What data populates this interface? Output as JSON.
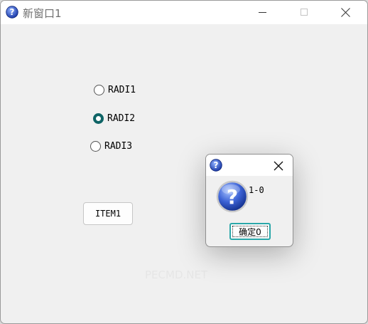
{
  "window": {
    "title": "新窗口1",
    "icon": "question-icon"
  },
  "radios": [
    {
      "label": "RADI1",
      "checked": false
    },
    {
      "label": "RADI2",
      "checked": true
    },
    {
      "label": "RADI3",
      "checked": false
    }
  ],
  "item_button": {
    "label": "ITEM1"
  },
  "dialog": {
    "icon": "question-icon",
    "message": "1-0",
    "ok_label": "确定0"
  },
  "watermark": "PECMD.NET",
  "colors": {
    "radio_checked": "#0f6466",
    "focus_border": "#2aa7a9",
    "window_bg": "#f0f0f0"
  }
}
